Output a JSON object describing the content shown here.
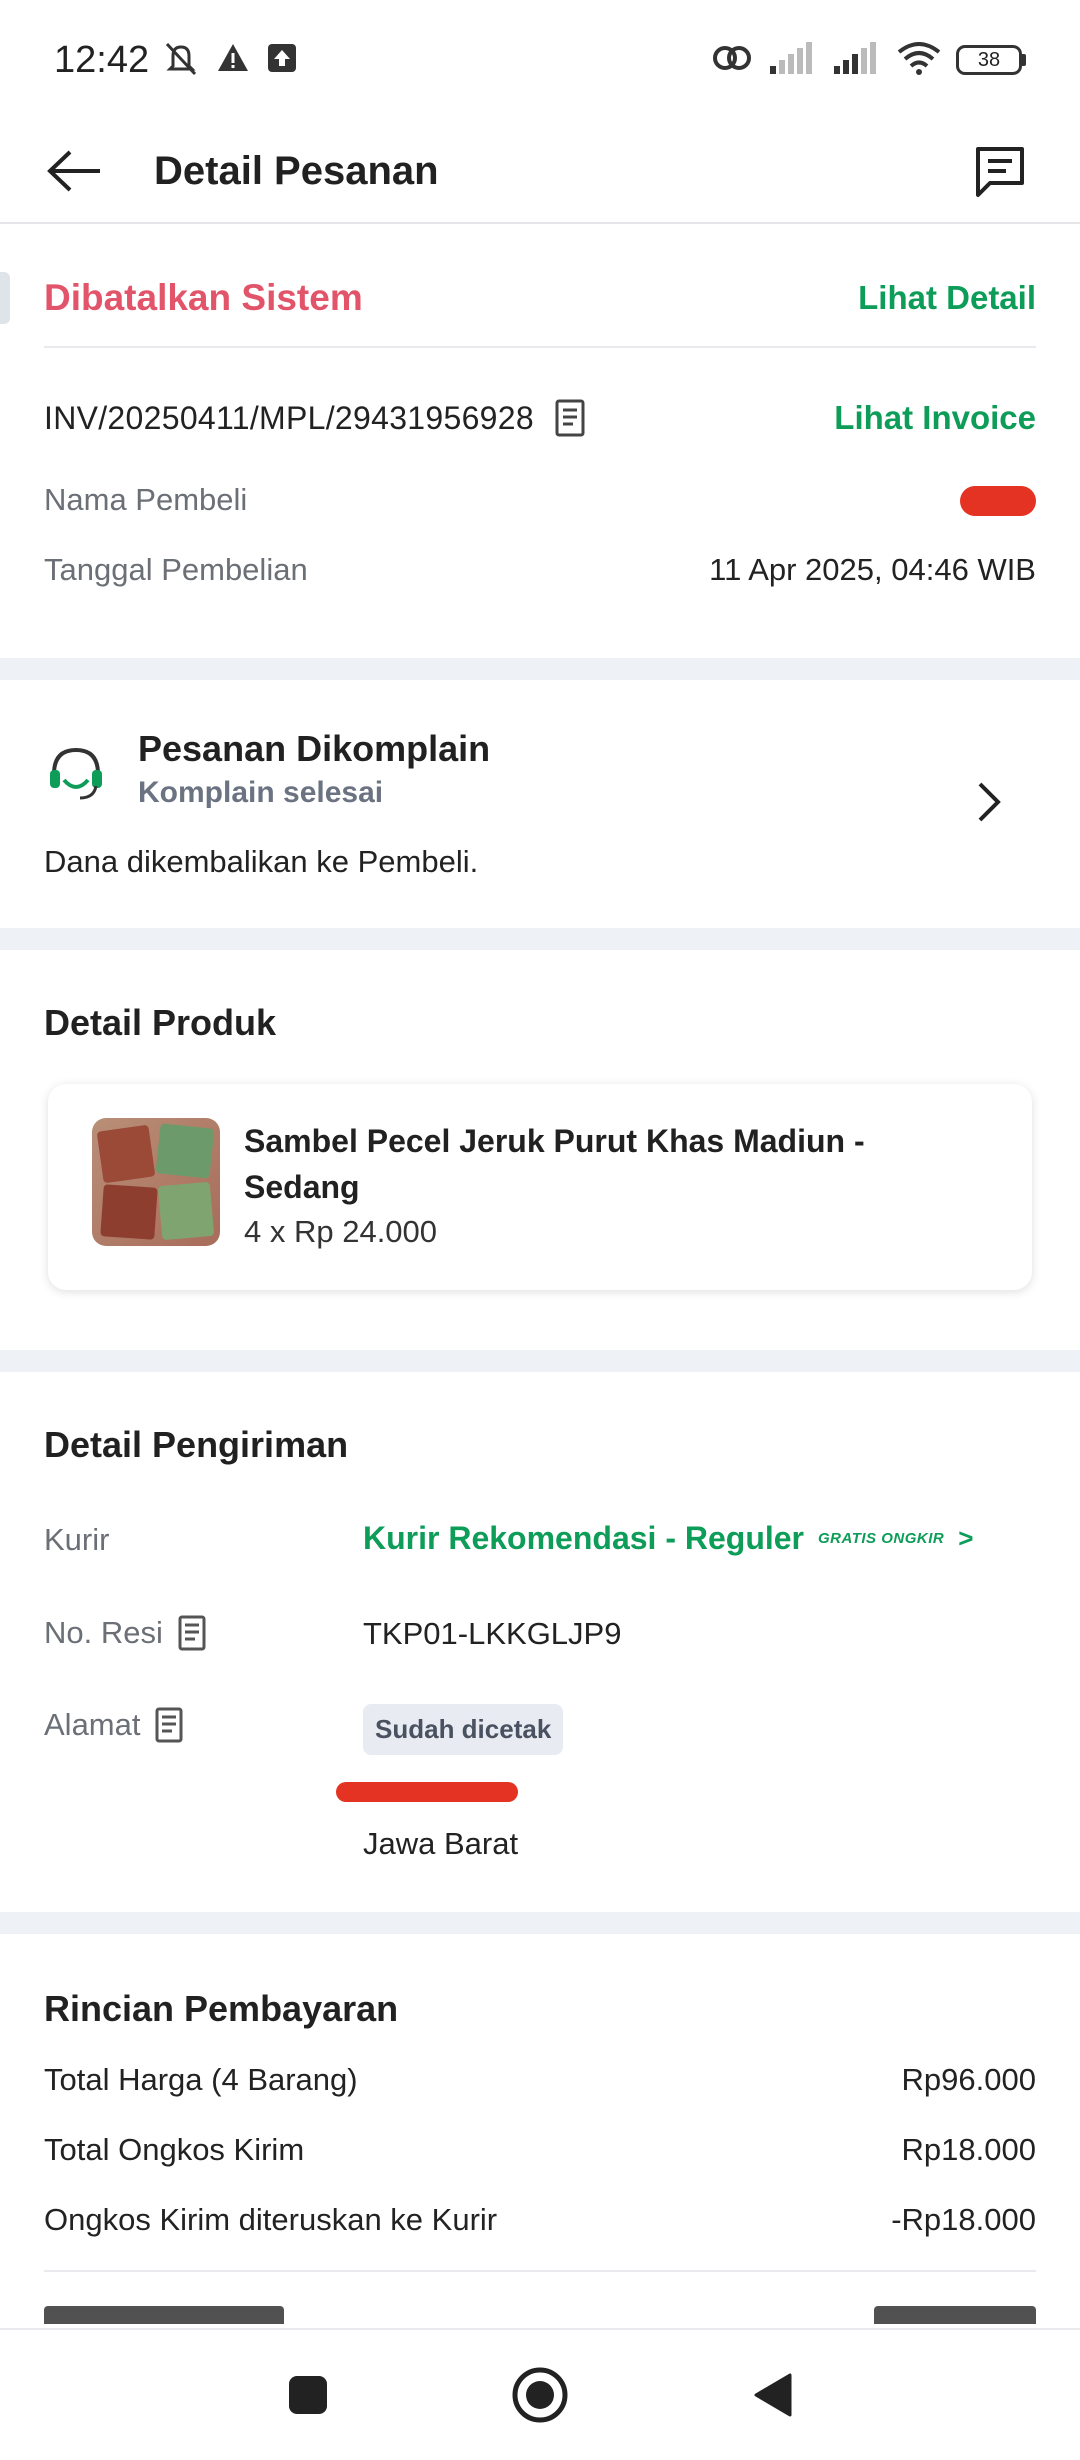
{
  "status_bar": {
    "time": "12:42",
    "battery": "38"
  },
  "header": {
    "title": "Detail Pesanan"
  },
  "order": {
    "status": "Dibatalkan Sistem",
    "see_detail": "Lihat Detail",
    "invoice_number": "INV/20250411/MPL/29431956928",
    "see_invoice": "Lihat Invoice",
    "buyer_label": "Nama Pembeli",
    "date_label": "Tanggal Pembelian",
    "date_value": "11 Apr 2025, 04:46 WIB"
  },
  "complaint": {
    "title": "Pesanan Dikomplain",
    "subtitle": "Komplain selesai",
    "description": "Dana dikembalikan ke Pembeli."
  },
  "product": {
    "heading": "Detail Produk",
    "name_line1": "Sambel Pecel Jeruk Purut Khas Madiun -",
    "name_line2": "Sedang",
    "quantity_price": "4 x Rp 24.000"
  },
  "shipping": {
    "heading": "Detail Pengiriman",
    "courier_label": "Kurir",
    "courier_value": "Kurir Rekomendasi - Reguler",
    "courier_badge": "GRATIS ONGKIR",
    "courier_chevron": ">",
    "resi_label": "No. Resi",
    "resi_value": "TKP01-LKKGLJP9",
    "address_label": "Alamat",
    "address_badge": "Sudah dicetak",
    "address_province": "Jawa Barat"
  },
  "payment": {
    "heading": "Rincian Pembayaran",
    "rows": [
      {
        "label": "Total Harga (4 Barang)",
        "amount": "Rp96.000"
      },
      {
        "label": "Total Ongkos Kirim",
        "amount": "Rp18.000"
      },
      {
        "label": "Ongkos Kirim diteruskan ke Kurir",
        "amount": "-Rp18.000"
      }
    ]
  },
  "colors": {
    "accent_green": "#0d9d58",
    "status_red": "#e2546a",
    "divider": "#eef1f6"
  }
}
